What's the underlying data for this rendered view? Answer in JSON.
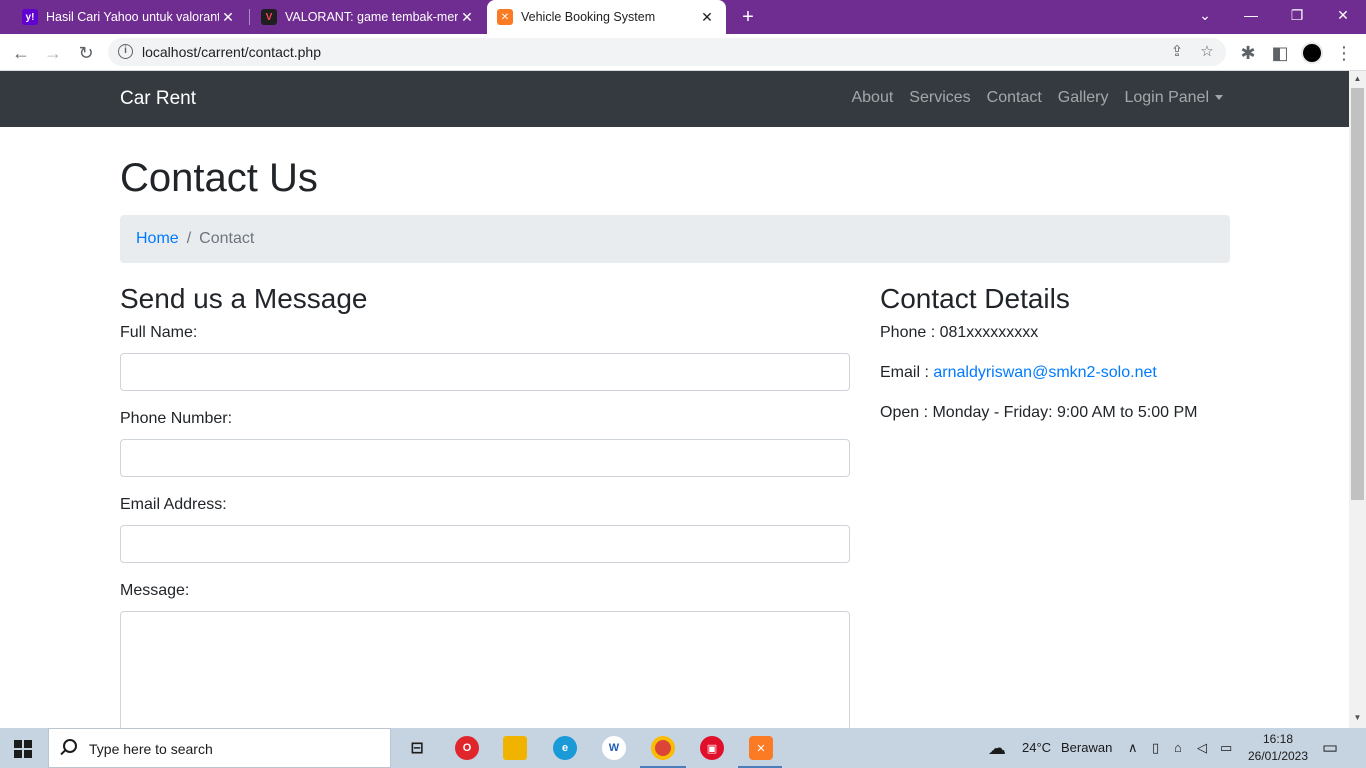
{
  "browser": {
    "tabs": [
      {
        "title": "Hasil Cari Yahoo untuk valorant",
        "favicon": "yahoo-icon",
        "active": false
      },
      {
        "title": "VALORANT: game tembak-menembak",
        "favicon": "valorant-icon",
        "active": false
      },
      {
        "title": "Vehicle Booking System",
        "favicon": "xampp-icon",
        "active": true
      }
    ],
    "url": "localhost/carrent/contact.php"
  },
  "navbar": {
    "brand": "Car Rent",
    "links": [
      "About",
      "Services",
      "Contact",
      "Gallery",
      "Login Panel"
    ]
  },
  "page": {
    "title": "Contact Us",
    "breadcrumb": {
      "home": "Home",
      "separator": "/",
      "current": "Contact"
    }
  },
  "form": {
    "heading": "Send us a Message",
    "full_name_label": "Full Name:",
    "phone_label": "Phone Number:",
    "email_label": "Email Address:",
    "message_label": "Message:"
  },
  "contact_details": {
    "heading": "Contact Details",
    "phone_label": "Phone :",
    "phone_value": "081xxxxxxxxx",
    "email_label": "Email :",
    "email_value": "arnaldyriswan@smkn2-solo.net",
    "open": "Open : Monday - Friday: 9:00 AM to 5:00 PM"
  },
  "taskbar": {
    "search_placeholder": "Type here to search",
    "weather_temp": "24°C",
    "weather_text": "Berawan",
    "time": "16:18",
    "date": "26/01/2023"
  },
  "colors": {
    "tabbar": "#6f2c91",
    "navbar": "#343a40",
    "link": "#007bff",
    "breadcrumb_bg": "#e9ecef"
  }
}
